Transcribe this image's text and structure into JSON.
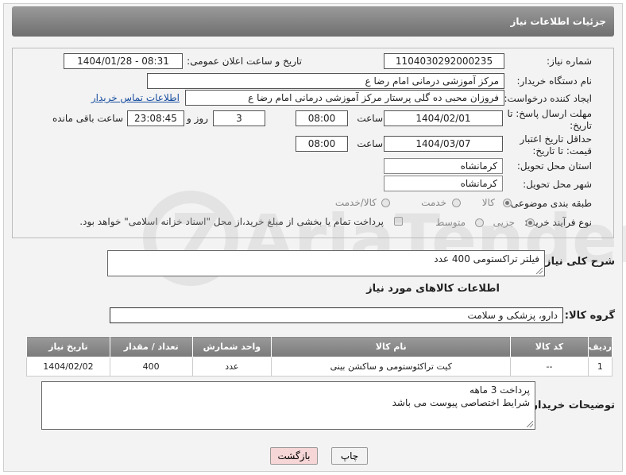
{
  "header": {
    "title": "جزئیات اطلاعات نیاز"
  },
  "form": {
    "need_number_label": "شماره نیاز:",
    "need_number": "1104030292000235",
    "announce_label": "تاریخ و ساعت اعلان عمومی:",
    "announce_value": "1404/01/28 - 08:31",
    "buyer_org_label": "نام دستگاه خریدار:",
    "buyer_org": "مرکز آموزشی  درمانی امام رضا  ع",
    "requester_label": "ایجاد کننده درخواست:",
    "requester": "فروزان محبی ده گلی پرستار مرکز آموزشی  درمانی امام رضا  ع",
    "contact_link": "اطلاعات تماس خریدار",
    "reply_deadline_label": "مهلت ارسال پاسخ: تا تاریخ:",
    "reply_date": "1404/02/01",
    "time_label": "ساعت",
    "reply_time": "08:00",
    "days_value": "3",
    "days_label": "روز و",
    "remaining_time": "23:08:45",
    "remaining_label": "ساعت باقی مانده",
    "price_validity_label": "حداقل تاریخ اعتبار قیمت: تا تاریخ:",
    "validity_date": "1404/03/07",
    "validity_time": "08:00",
    "province_label": "استان محل تحویل:",
    "province": "کرمانشاه",
    "city_label": "شهر محل تحویل:",
    "city": "کرمانشاه",
    "category_label": "طبقه بندی موضوعی:",
    "category_options": [
      "کالا",
      "خدمت",
      "کالا/خدمت"
    ],
    "category_selected": "کالا",
    "process_label": "نوع فرآیند خرید :",
    "process_options": [
      "جزیی",
      "متوسط"
    ],
    "process_selected": "جزیی",
    "payment_note": "پرداخت تمام یا بخشی از مبلغ خرید،از محل \"اسناد خزانه اسلامی\" خواهد بود."
  },
  "description": {
    "label": "شرح کلی نیاز:",
    "value": "فیلتر تراکستومی 400 عدد"
  },
  "goods_info": {
    "heading": "اطلاعات کالاهای مورد نیاز",
    "group_label": "گروه کالا:",
    "group_value": "دارو، پزشکی و سلامت"
  },
  "table": {
    "headers": [
      "ردیف",
      "کد کالا",
      "نام کالا",
      "واحد شمارش",
      "تعداد / مقدار",
      "تاریخ نیاز"
    ],
    "rows": [
      [
        "1",
        "--",
        "کیت تراکئوستومی و ساکشن بینی",
        "عدد",
        "400",
        "1404/02/02"
      ]
    ]
  },
  "buyer_notes": {
    "label": "توضیحات خریدار:",
    "line1": "پرداخت 3 ماهه",
    "line2": "شرایط اختصاصی پیوست می باشد"
  },
  "buttons": {
    "print": "چاپ",
    "back": "بازگشت"
  },
  "watermark": {
    "text": "AriaTender.net"
  },
  "colors": {
    "header_bg": "#7f7f7f",
    "link": "#1a4fa0",
    "back_button": "#f6d6d6"
  }
}
